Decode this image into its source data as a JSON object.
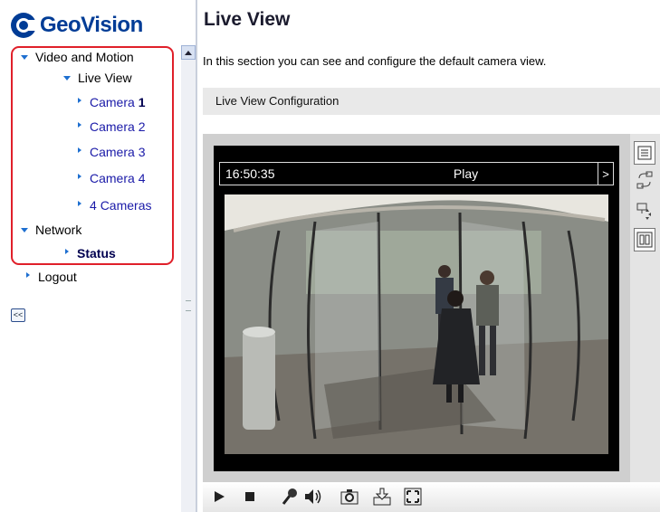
{
  "brand": {
    "name": "GeoVision"
  },
  "sidebar": {
    "video_and_motion": "Video and Motion",
    "live_view": "Live View",
    "cameras": [
      {
        "prefix": "Camera ",
        "num": "1"
      },
      {
        "prefix": "Camera ",
        "num": "2"
      },
      {
        "prefix": "Camera ",
        "num": "3"
      },
      {
        "prefix": "Camera ",
        "num": "4"
      },
      {
        "prefix": "4 ",
        "num": "Cameras"
      }
    ],
    "network": "Network",
    "status": "Status",
    "logout": "Logout",
    "collapse": "<<"
  },
  "main": {
    "title": "Live View",
    "intro": "In this section you can see and configure the default camera view.",
    "config_bar": "Live View Configuration"
  },
  "viewer": {
    "time": "16:50:35",
    "mode": "Play",
    "next": ">"
  },
  "colors": {
    "accent_blue": "#1e6fd0",
    "highlight_box": "#e0202a",
    "brand_blue": "#003c96"
  },
  "icons": {
    "side": [
      "settings-list-icon",
      "switch-camera-icon",
      "ptz-control-icon",
      "io-control-icon"
    ],
    "bottom": [
      "play-icon",
      "stop-icon",
      "microphone-icon",
      "speaker-icon",
      "snapshot-icon",
      "download-icon",
      "fullscreen-icon"
    ]
  }
}
